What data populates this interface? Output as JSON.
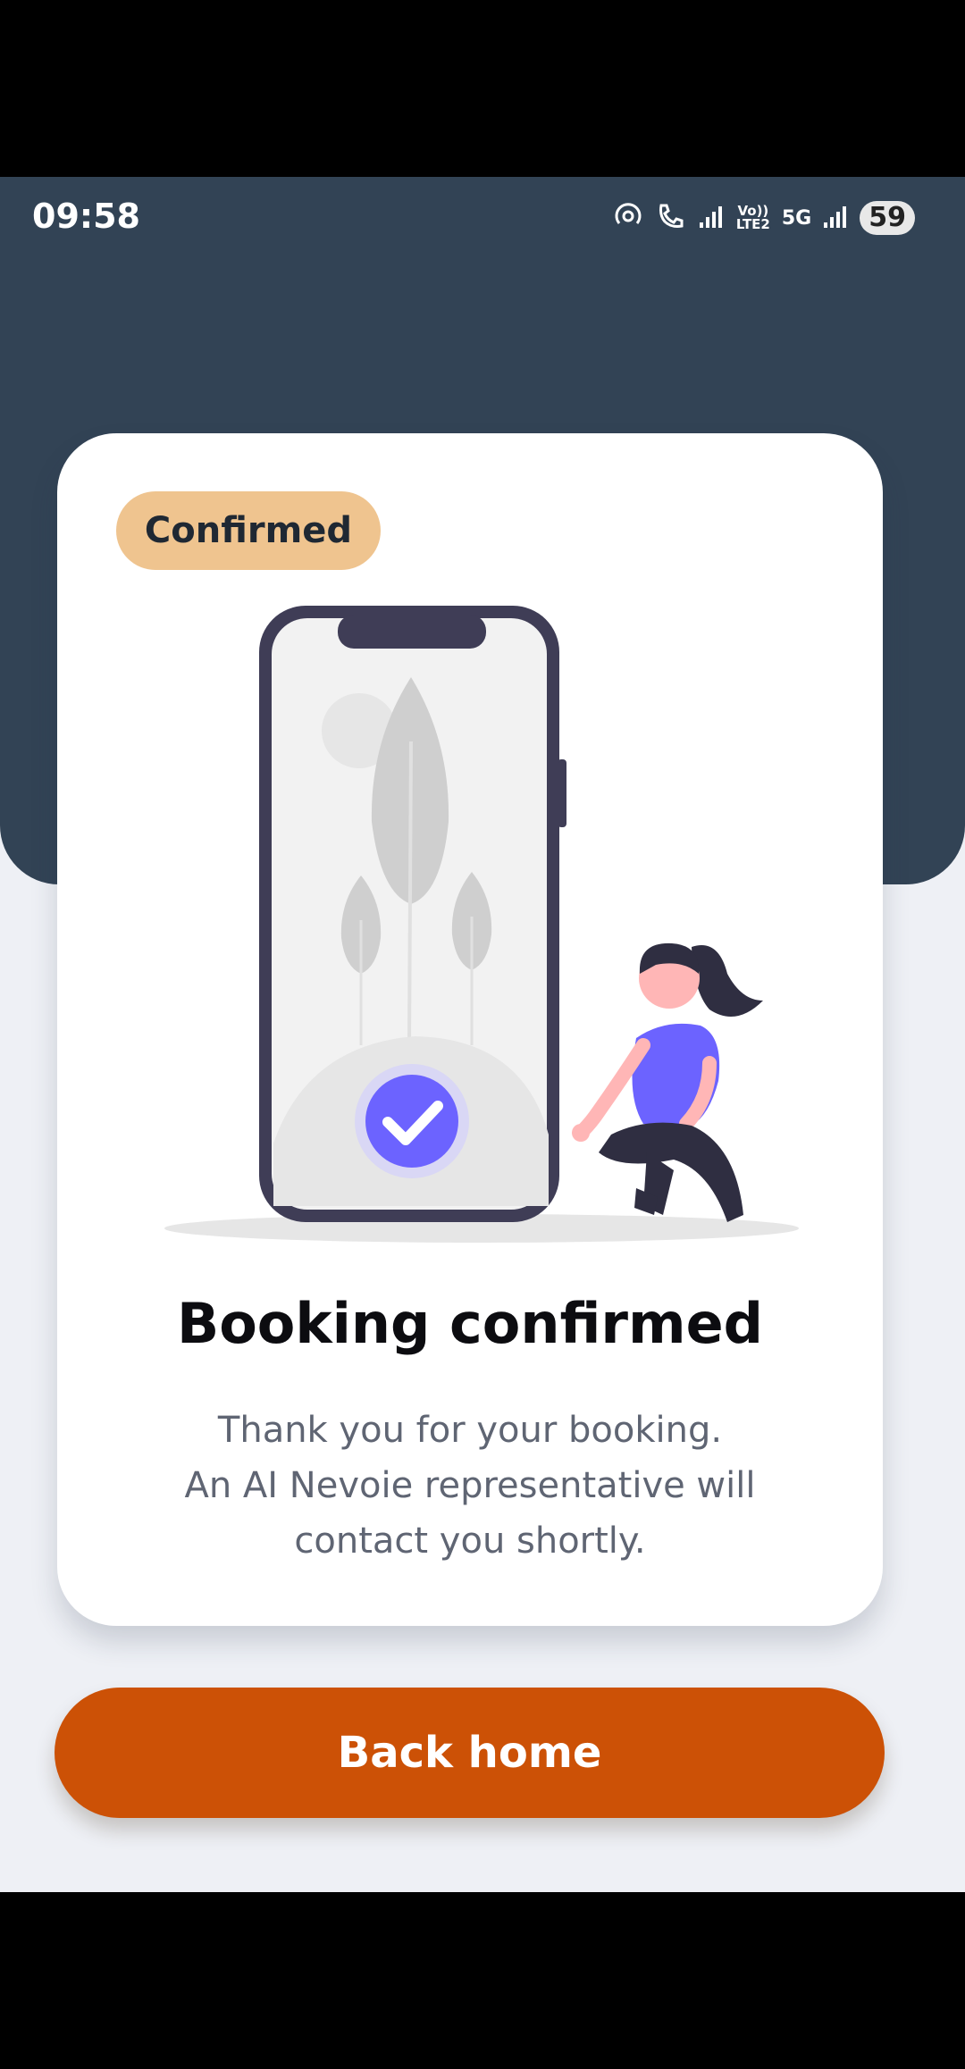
{
  "status_bar": {
    "time": "09:58",
    "battery": "59",
    "network_1": "Vo)) LTE2",
    "network_2": "5G"
  },
  "card": {
    "badge": "Confirmed",
    "title": "Booking confirmed",
    "message_line_1": "Thank you for your booking.",
    "message_line_2": "An AI Nevoie representative will",
    "message_line_3": "contact you shortly."
  },
  "actions": {
    "back_home": "Back home"
  },
  "colors": {
    "header": "#324355",
    "badge": "#efc48f",
    "button": "#cc5106",
    "accent": "#6c63ff"
  },
  "icons": {
    "hotspot": "hotspot-icon",
    "call": "wifi-calling-icon",
    "signal": "signal-icon",
    "check": "check-icon"
  }
}
